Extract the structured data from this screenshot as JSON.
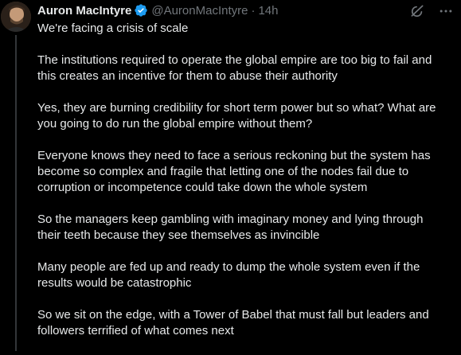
{
  "tweet": {
    "author_name": "Auron MacIntyre",
    "handle": "@AuronMacIntyre",
    "separator": "·",
    "time": "14h",
    "paragraphs": [
      "We're facing a crisis of scale",
      "The institutions required to operate the global empire are too big to fail and\nthis creates an incentive for them to abuse their authority",
      "Yes, they are burning credibility for short term power but so what? What are\nyou going to do run the global empire without them?",
      "Everyone knows they need to face a serious reckoning but the system has\nbecome so complex and fragile that letting one of the nodes fail due to\ncorruption or incompetence could take down the whole system",
      "So the managers keep gambling with imaginary money and lying through\ntheir teeth because they see themselves as invincible",
      "Many people are fed up and ready to dump the whole system even if the\nresults would be catastrophic",
      "So we sit on the edge, with a Tower of Babel that must fall but leaders and\nfollowers terrified of what comes next"
    ]
  },
  "icons": {
    "verified": "verified-badge-icon",
    "grok": "grok-icon",
    "more": "more-options-icon"
  },
  "colors": {
    "background": "#000000",
    "text": "#e7e9ea",
    "secondary": "#71767b",
    "verified": "#1d9bf0",
    "thread_line": "#333639"
  }
}
